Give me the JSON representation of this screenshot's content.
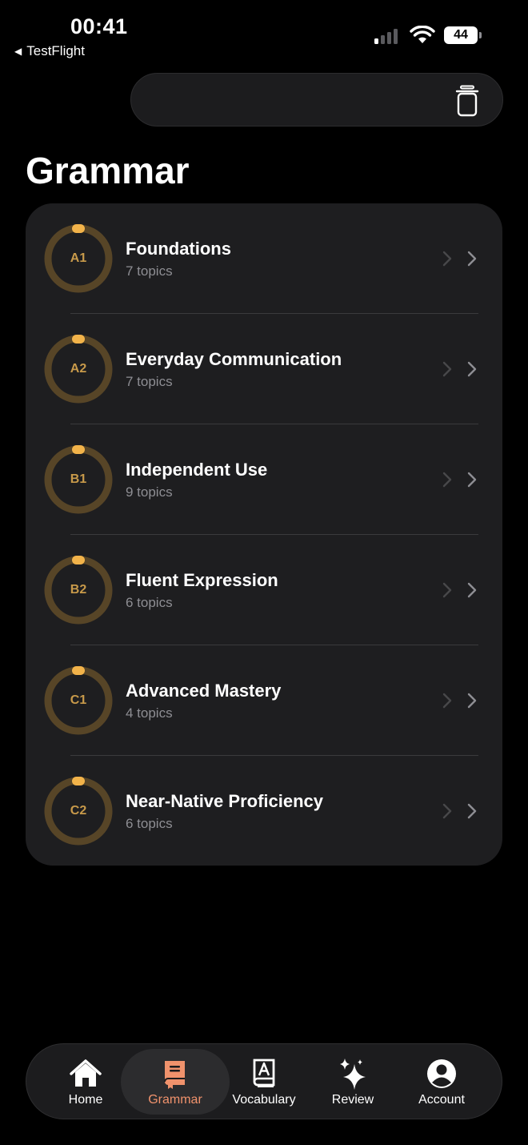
{
  "status": {
    "time": "00:41",
    "back_app": "TestFlight",
    "battery": "44"
  },
  "page": {
    "title": "Grammar"
  },
  "levels": [
    {
      "code": "A1",
      "title": "Foundations",
      "topics": "7 topics"
    },
    {
      "code": "A2",
      "title": "Everyday Communication",
      "topics": "7 topics"
    },
    {
      "code": "B1",
      "title": "Independent Use",
      "topics": "9 topics"
    },
    {
      "code": "B2",
      "title": "Fluent Expression",
      "topics": "6 topics"
    },
    {
      "code": "C1",
      "title": "Advanced Mastery",
      "topics": "4 topics"
    },
    {
      "code": "C2",
      "title": "Near-Native Proficiency",
      "topics": "6 topics"
    }
  ],
  "tabs": [
    {
      "label": "Home",
      "icon": "house-icon"
    },
    {
      "label": "Grammar",
      "icon": "book-icon",
      "active": true
    },
    {
      "label": "Vocabulary",
      "icon": "dictionary-icon"
    },
    {
      "label": "Review",
      "icon": "sparkles-icon"
    },
    {
      "label": "Account",
      "icon": "person-icon"
    }
  ],
  "colors": {
    "ring_track": "#574527",
    "ring_progress": "#f2b34a",
    "level_text": "#c89a4a",
    "accent": "#f0926c"
  }
}
